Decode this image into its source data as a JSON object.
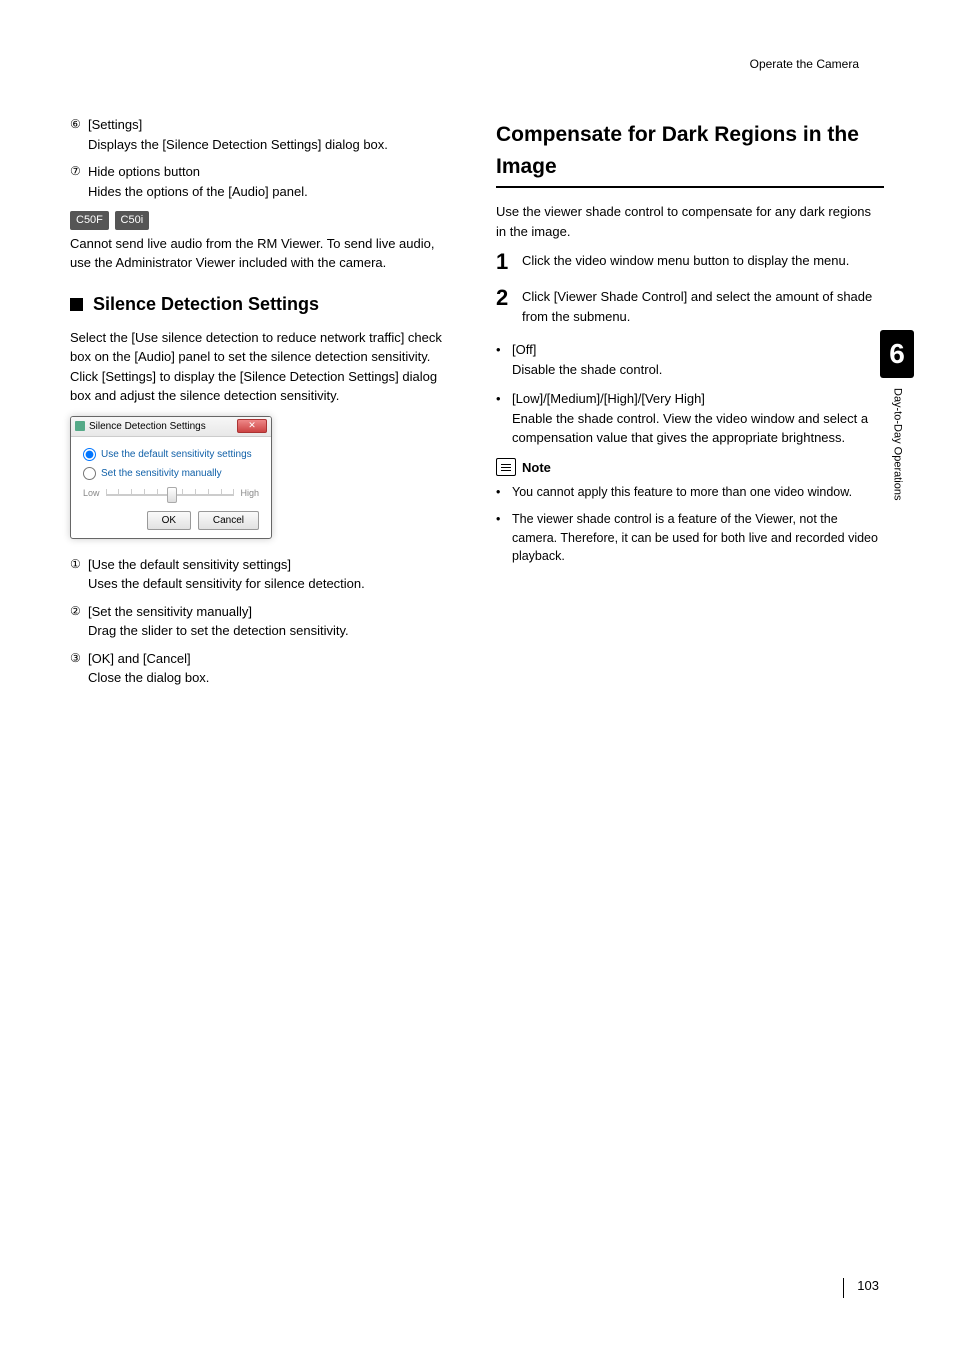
{
  "header": {
    "breadcrumb": "Operate the Camera"
  },
  "left": {
    "items_top": [
      {
        "marker": "⑥",
        "title": "[Settings]",
        "desc": "Displays the [Silence Detection Settings] dialog box."
      },
      {
        "marker": "⑦",
        "title": "Hide options button",
        "desc": "Hides the options of the [Audio] panel."
      }
    ],
    "badges": [
      "C50F",
      "C50i"
    ],
    "badge_note": "Cannot send live audio from the RM Viewer. To send live audio, use the Administrator Viewer included with the camera.",
    "subheading": "Silence Detection Settings",
    "sub_para": "Select the [Use silence detection to reduce network traffic] check box on the [Audio] panel to set the silence detection sensitivity.\nClick [Settings] to display the [Silence Detection Settings] dialog box and adjust the silence detection sensitivity.",
    "dialog": {
      "title": "Silence Detection Settings",
      "opt1": "Use the default sensitivity settings",
      "opt2": "Set the sensitivity manually",
      "low": "Low",
      "high": "High",
      "ok": "OK",
      "cancel": "Cancel"
    },
    "items_bottom": [
      {
        "marker": "①",
        "title": "[Use the default sensitivity settings]",
        "desc": "Uses the default sensitivity for silence detection."
      },
      {
        "marker": "②",
        "title": "[Set the sensitivity manually]",
        "desc": "Drag the slider to set the detection sensitivity."
      },
      {
        "marker": "③",
        "title": "[OK] and [Cancel]",
        "desc": "Close the dialog box."
      }
    ]
  },
  "right": {
    "heading": "Compensate for Dark Regions in the Image",
    "intro": "Use the viewer shade control to compensate for any dark regions in the image.",
    "steps": [
      "Click the video window menu button to display the menu.",
      "Click [Viewer Shade Control] and select the amount of shade from the submenu."
    ],
    "options": [
      {
        "title": "[Off]",
        "desc": "Disable the shade control."
      },
      {
        "title": "[Low]/[Medium]/[High]/[Very High]",
        "desc": "Enable the shade control. View the video window and select a compensation value that gives the appropriate brightness."
      }
    ],
    "note_label": "Note",
    "notes": [
      "You cannot apply this feature to more than one video window.",
      "The viewer shade control is a feature of the Viewer, not the camera. Therefore, it can be used for both live and recorded video playback."
    ]
  },
  "side": {
    "chapter_num": "6",
    "chapter_title": "Day-to-Day Operations"
  },
  "page_number": "103"
}
